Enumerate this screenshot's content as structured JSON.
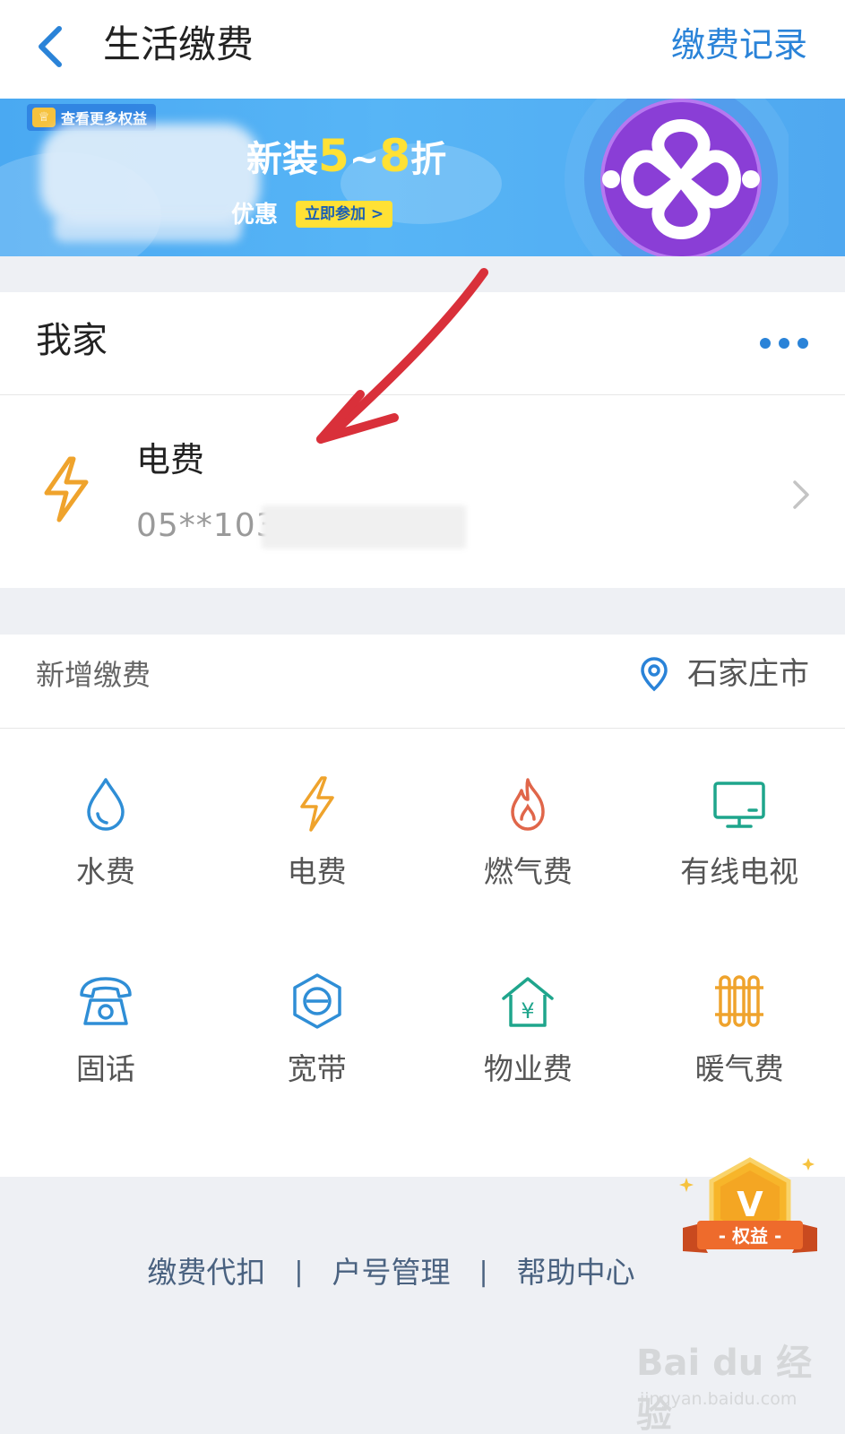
{
  "header": {
    "title": "生活缴费",
    "records_link": "缴费记录"
  },
  "banner": {
    "badge_text": "查看更多权益",
    "headline_prefix": "新装",
    "headline_num1": "5",
    "headline_tilde": "~",
    "headline_num2": "8",
    "headline_suffix": "折",
    "subline": "优惠",
    "join_button": "立即参加 >",
    "logo": "china-unicom-logo"
  },
  "home": {
    "title": "我家",
    "bill": {
      "name": "电费",
      "account": "05**103",
      "icon": "lightning-icon"
    }
  },
  "add_payment": {
    "title": "新增缴费",
    "city": "石家庄市",
    "items": [
      {
        "label": "水费",
        "icon": "water-drop-icon",
        "color": "#2f8ed6"
      },
      {
        "label": "电费",
        "icon": "lightning-icon",
        "color": "#efa32c"
      },
      {
        "label": "燃气费",
        "icon": "flame-icon",
        "color": "#e0664a"
      },
      {
        "label": "有线电视",
        "icon": "tv-icon",
        "color": "#1fa58c"
      },
      {
        "label": "固话",
        "icon": "telephone-icon",
        "color": "#2f8ed6"
      },
      {
        "label": "宽带",
        "icon": "broadband-icon",
        "color": "#2f8ed6"
      },
      {
        "label": "物业费",
        "icon": "property-house-icon",
        "color": "#1fa58c"
      },
      {
        "label": "暖气费",
        "icon": "radiator-icon",
        "color": "#efa32c"
      }
    ]
  },
  "footer": {
    "links": [
      "缴费代扣",
      "户号管理",
      "帮助中心"
    ],
    "separator": "|"
  },
  "perk_badge": {
    "label": "- 权益 -",
    "letter": "V"
  },
  "watermark": {
    "brand": "Bai du 经验",
    "url": "jingyan.baidu.com"
  },
  "colors": {
    "accent_blue": "#2a83d8",
    "annotation_red": "#d9303a"
  }
}
